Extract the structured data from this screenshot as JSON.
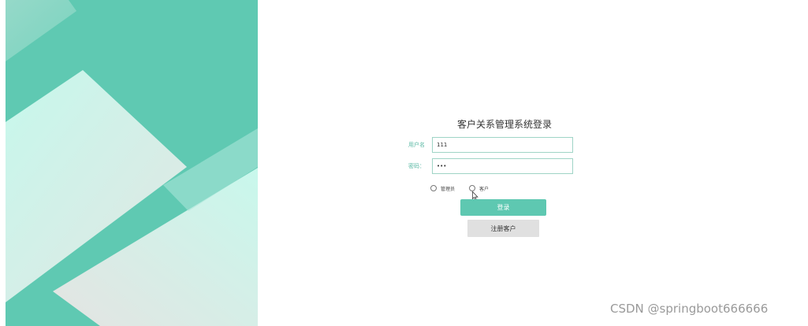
{
  "login": {
    "title": "客户关系管理系统登录",
    "username_label": "用户名",
    "username_value": "111",
    "password_label": "密码：",
    "password_value": "111",
    "roles": {
      "admin_label": "管理员",
      "customer_label": "客户"
    },
    "login_button_label": "登录",
    "register_button_label": "注册客户"
  },
  "watermark": {
    "text": "CSDN @springboot666666"
  },
  "colors": {
    "accent": "#5ec8b1",
    "background_panel": "#5fc9b2",
    "light_mint": "#c8f7ec",
    "label_color": "#5ab8a4",
    "register_bg": "#e0e0e0"
  }
}
